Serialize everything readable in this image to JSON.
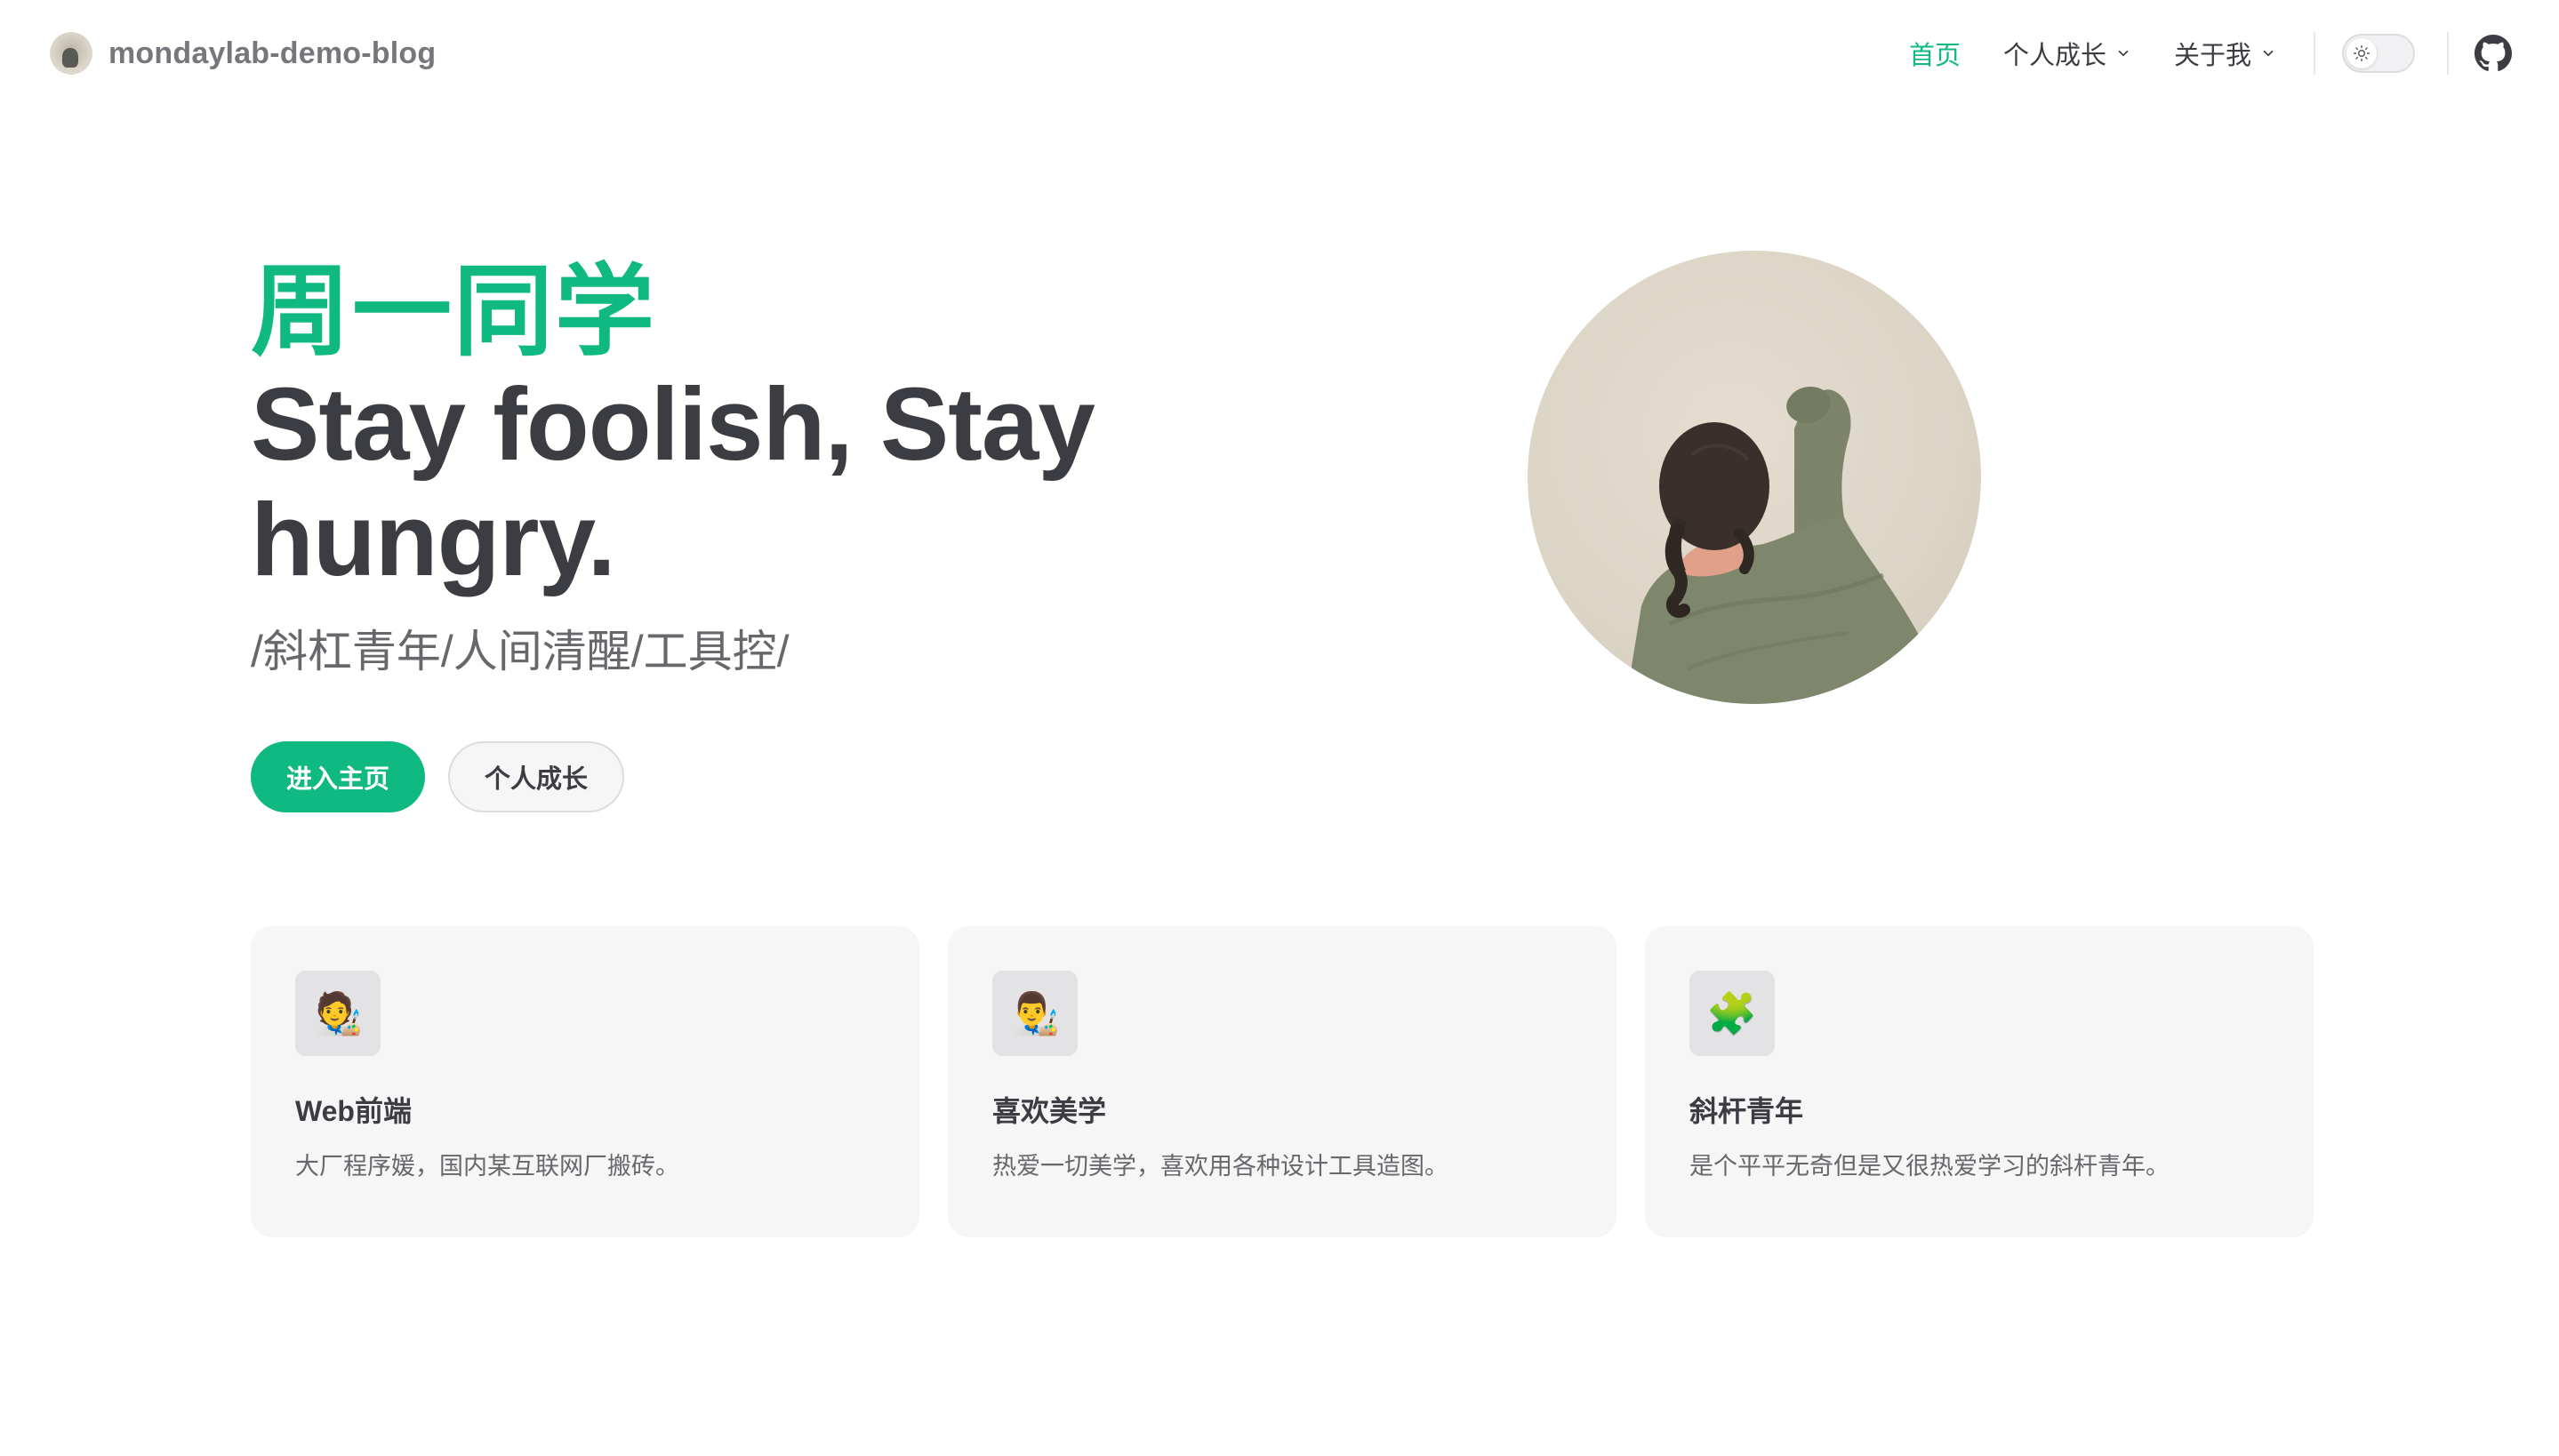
{
  "nav": {
    "site_title": "mondaylab-demo-blog",
    "links": [
      {
        "label": "首页",
        "active": true
      },
      {
        "label": "个人成长",
        "dropdown": true
      },
      {
        "label": "关于我",
        "dropdown": true
      }
    ],
    "theme_icon": "sun-icon",
    "social_icon": "github-icon"
  },
  "hero": {
    "name": "周一同学",
    "text": "Stay foolish, Stay hungry.",
    "tagline": "/斜杠青年/人间清醒/工具控/",
    "actions": [
      {
        "label": "进入主页",
        "theme": "brand"
      },
      {
        "label": "个人成长",
        "theme": "alt"
      }
    ]
  },
  "features": [
    {
      "icon": "🧑‍🎨",
      "title": "Web前端",
      "details": "大厂程序媛，国内某互联网厂搬砖。"
    },
    {
      "icon": "👨‍🎨",
      "title": "喜欢美学",
      "details": "热爱一切美学，喜欢用各种设计工具造图。"
    },
    {
      "icon": "🧩",
      "title": "斜杆青年",
      "details": "是个平平无奇但是又很热爱学习的斜杆青年。"
    }
  ],
  "colors": {
    "brand": "#10b981",
    "text": "#3c3c43",
    "muted": "#67676c",
    "card_bg": "#f6f6f7"
  }
}
